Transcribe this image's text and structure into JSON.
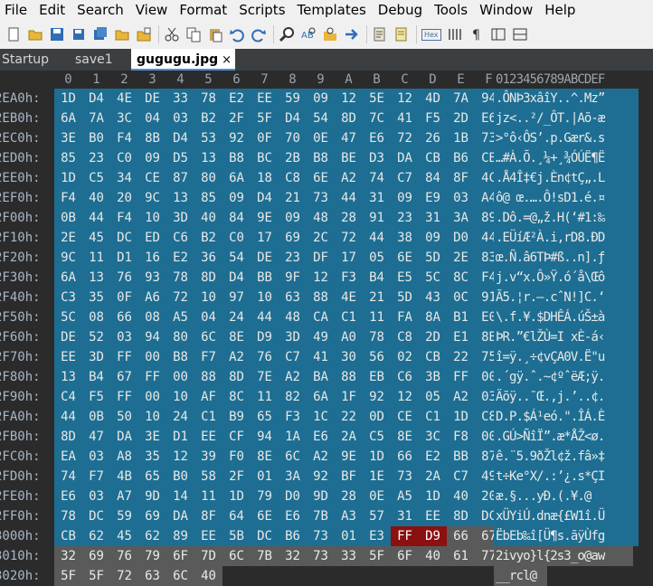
{
  "menu": [
    "File",
    "Edit",
    "Search",
    "View",
    "Format",
    "Scripts",
    "Templates",
    "Debug",
    "Tools",
    "Window",
    "Help"
  ],
  "toolbar": {
    "icons": [
      "new-file-icon",
      "open-folder-icon",
      "save-icon",
      "save-as-icon",
      "save-all-icon",
      "open-folder-icon",
      "open-recent-icon",
      "cut-icon",
      "copy-icon",
      "paste-icon",
      "undo-icon",
      "redo-icon",
      "find-icon",
      "replace-icon",
      "find-in-files-icon",
      "goto-icon",
      "script-icon",
      "template-icon"
    ],
    "hex_toggle_label": "Hex",
    "extra_icons": [
      "columns-icon",
      "pilcrow-icon",
      "layout-icon",
      "split-icon"
    ]
  },
  "tabs": [
    {
      "label": "Startup",
      "active": false
    },
    {
      "label": "save1",
      "active": false
    },
    {
      "label": "gugugu.jpg",
      "active": true,
      "close": "×"
    }
  ],
  "header": {
    "columns": [
      "0",
      "1",
      "2",
      "3",
      "4",
      "5",
      "6",
      "7",
      "8",
      "9",
      "A",
      "B",
      "C",
      "D",
      "E",
      "F"
    ],
    "ascii_header": "0123456789ABCDEF"
  },
  "rows": [
    {
      "offset": "2EA0h:",
      "bytes": [
        "1D",
        "D4",
        "4E",
        "DE",
        "33",
        "78",
        "E2",
        "EE",
        "59",
        "09",
        "12",
        "5E",
        "12",
        "4D",
        "7A",
        "94"
      ],
      "ascii": ".ÔNÞ3xâîY..^.Mz”",
      "hl": {}
    },
    {
      "offset": "2EB0h:",
      "bytes": [
        "6A",
        "7A",
        "3C",
        "04",
        "03",
        "B2",
        "2F",
        "5F",
        "D4",
        "54",
        "8D",
        "7C",
        "41",
        "F5",
        "2D",
        "E6"
      ],
      "ascii": "jz<..²/_ÔT.|Aõ-æ",
      "hl": {}
    },
    {
      "offset": "2EC0h:",
      "bytes": [
        "3E",
        "B0",
        "F4",
        "8B",
        "D4",
        "53",
        "92",
        "0F",
        "70",
        "0E",
        "47",
        "E6",
        "72",
        "26",
        "1B",
        "73"
      ],
      "ascii": ">°ô‹ÔS’.p.Gær&.s",
      "hl": {}
    },
    {
      "offset": "2ED0h:",
      "bytes": [
        "85",
        "23",
        "C0",
        "09",
        "D5",
        "13",
        "B8",
        "BC",
        "2B",
        "B8",
        "BE",
        "D3",
        "DA",
        "CB",
        "B6",
        "CB"
      ],
      "ascii": "…#À.Õ.¸¼+¸¾ÓÚË¶Ë",
      "hl": {}
    },
    {
      "offset": "2EE0h:",
      "bytes": [
        "1D",
        "C5",
        "34",
        "CE",
        "87",
        "80",
        "6A",
        "18",
        "C8",
        "6E",
        "A2",
        "74",
        "C7",
        "84",
        "8F",
        "4C"
      ],
      "ascii": ".Å4Î‡€j.Èn¢tÇ„.L",
      "hl": {}
    },
    {
      "offset": "2EF0h:",
      "bytes": [
        "F4",
        "40",
        "20",
        "9C",
        "13",
        "85",
        "09",
        "D4",
        "21",
        "73",
        "44",
        "31",
        "09",
        "E9",
        "03",
        "A4"
      ],
      "ascii": "ô@ œ.….Ô!sD1.é.¤",
      "hl": {}
    },
    {
      "offset": "2F00h:",
      "bytes": [
        "0B",
        "44",
        "F4",
        "10",
        "3D",
        "40",
        "84",
        "9E",
        "09",
        "48",
        "28",
        "91",
        "23",
        "31",
        "3A",
        "89"
      ],
      "ascii": ".Dô.=@„ž.H(‘#1:‰",
      "hl": {}
    },
    {
      "offset": "2F10h:",
      "bytes": [
        "2E",
        "45",
        "DC",
        "ED",
        "C6",
        "B2",
        "C0",
        "17",
        "69",
        "2C",
        "72",
        "44",
        "38",
        "09",
        "D0",
        "44"
      ],
      "ascii": ".EÜíÆ²À.i,rD8.ÐD",
      "hl": {}
    },
    {
      "offset": "2F20h:",
      "bytes": [
        "9C",
        "11",
        "D1",
        "16",
        "E2",
        "36",
        "54",
        "DE",
        "23",
        "DF",
        "17",
        "05",
        "6E",
        "5D",
        "2E",
        "83"
      ],
      "ascii": "œ.Ñ.â6TÞ#ß..n].ƒ",
      "hl": {}
    },
    {
      "offset": "2F30h:",
      "bytes": [
        "6A",
        "13",
        "76",
        "93",
        "78",
        "8D",
        "D4",
        "BB",
        "9F",
        "12",
        "F3",
        "B4",
        "E5",
        "5C",
        "8C",
        "F4"
      ],
      "ascii": "j.v“x.Ô»Ÿ.ó´å\\Œô",
      "hl": {}
    },
    {
      "offset": "2F40h:",
      "bytes": [
        "C3",
        "35",
        "0F",
        "A6",
        "72",
        "10",
        "97",
        "10",
        "63",
        "88",
        "4E",
        "21",
        "5D",
        "43",
        "0C",
        "91"
      ],
      "ascii": "Ã5.¦r.—.cˆN!]C.‘",
      "hl": {}
    },
    {
      "offset": "2F50h:",
      "bytes": [
        "5C",
        "08",
        "66",
        "08",
        "A5",
        "04",
        "24",
        "44",
        "48",
        "CA",
        "C1",
        "11",
        "FA",
        "8A",
        "B1",
        "E0"
      ],
      "ascii": "\\.f.¥.$DHÊÁ.úŠ±à",
      "hl": {}
    },
    {
      "offset": "2F60h:",
      "bytes": [
        "DE",
        "52",
        "03",
        "94",
        "80",
        "6C",
        "8E",
        "D9",
        "3D",
        "49",
        "A0",
        "78",
        "C8",
        "2D",
        "E1",
        "8B"
      ],
      "ascii": "ÞR.”€lŽÙ=I xÈ-á‹",
      "hl": {}
    },
    {
      "offset": "2F70h:",
      "bytes": [
        "EE",
        "3D",
        "FF",
        "00",
        "B8",
        "F7",
        "A2",
        "76",
        "C7",
        "41",
        "30",
        "56",
        "02",
        "CB",
        "22",
        "75"
      ],
      "ascii": "î=ÿ.¸÷¢vÇA0V.Ë\"u",
      "hl": {}
    },
    {
      "offset": "2F80h:",
      "bytes": [
        "13",
        "B4",
        "67",
        "FF",
        "00",
        "88",
        "8D",
        "7E",
        "A2",
        "BA",
        "88",
        "EB",
        "C6",
        "3B",
        "FF",
        "00"
      ],
      "ascii": ".´gÿ.ˆ.~¢ºˆëÆ;ÿ.",
      "hl": {}
    },
    {
      "offset": "2F90h:",
      "bytes": [
        "C4",
        "F5",
        "FF",
        "00",
        "10",
        "AF",
        "8C",
        "11",
        "82",
        "6A",
        "1F",
        "92",
        "12",
        "05",
        "A2",
        "03"
      ],
      "ascii": "Äõÿ..¯Œ.‚j.’..¢.",
      "hl": {}
    },
    {
      "offset": "2FA0h:",
      "bytes": [
        "44",
        "0B",
        "50",
        "10",
        "24",
        "C1",
        "B9",
        "65",
        "F3",
        "1C",
        "22",
        "0D",
        "CE",
        "C1",
        "1D",
        "C8"
      ],
      "ascii": "D.P.$Á¹eó.\".ÎÁ.È",
      "hl": {}
    },
    {
      "offset": "2FB0h:",
      "bytes": [
        "8D",
        "47",
        "DA",
        "3E",
        "D1",
        "EE",
        "CF",
        "94",
        "1A",
        "E6",
        "2A",
        "C5",
        "8E",
        "3C",
        "F8",
        "00"
      ],
      "ascii": ".GÚ>ÑîÏ”.æ*ÅŽ<ø.",
      "hl": {}
    },
    {
      "offset": "2FC0h:",
      "bytes": [
        "EA",
        "03",
        "A8",
        "35",
        "12",
        "39",
        "F0",
        "8E",
        "6C",
        "A2",
        "9E",
        "1D",
        "66",
        "E2",
        "BB",
        "87"
      ],
      "ascii": "ê.¨5.9ðŽl¢ž.fâ»‡",
      "hl": {}
    },
    {
      "offset": "2FD0h:",
      "bytes": [
        "74",
        "F7",
        "4B",
        "65",
        "B0",
        "58",
        "2F",
        "01",
        "3A",
        "92",
        "BF",
        "1E",
        "73",
        "2A",
        "C7",
        "49"
      ],
      "ascii": "t÷Ke°X/.:’¿.s*ÇI",
      "hl": {}
    },
    {
      "offset": "2FE0h:",
      "bytes": [
        "E6",
        "03",
        "A7",
        "9D",
        "14",
        "11",
        "1D",
        "79",
        "D0",
        "9D",
        "28",
        "0E",
        "A5",
        "1D",
        "40",
        "20"
      ],
      "ascii": "æ.§...yÐ.(.¥.@ ",
      "hl": {}
    },
    {
      "offset": "2FF0h:",
      "bytes": [
        "78",
        "DC",
        "59",
        "69",
        "DA",
        "8F",
        "64",
        "6E",
        "E6",
        "7B",
        "A3",
        "57",
        "31",
        "EE",
        "8D",
        "DC"
      ],
      "ascii": "xÜYiÚ.dnæ{£W1î.Ü",
      "hl": {}
    },
    {
      "offset": "3000h:",
      "bytes": [
        "CB",
        "62",
        "45",
        "62",
        "89",
        "EE",
        "5B",
        "DC",
        "B6",
        "73",
        "01",
        "E3",
        "FF",
        "D9",
        "66",
        "67"
      ],
      "ascii": "ËbEb‰î[Ü¶s.ãÿÙfg",
      "hl": {
        "red": [
          12,
          13
        ],
        "gray_from": 14
      }
    },
    {
      "offset": "3010h:",
      "bytes": [
        "32",
        "69",
        "76",
        "79",
        "6F",
        "7D",
        "6C",
        "7B",
        "32",
        "73",
        "33",
        "5F",
        "6F",
        "40",
        "61",
        "77"
      ],
      "ascii": "2ivyo}l{2s3_o@aw",
      "hl": {
        "gray_all": true
      }
    },
    {
      "offset": "3020h:",
      "bytes": [
        "5F",
        "5F",
        "72",
        "63",
        "6C",
        "40"
      ],
      "ascii": "__rcl@",
      "hl": {
        "gray_all": true
      }
    }
  ]
}
